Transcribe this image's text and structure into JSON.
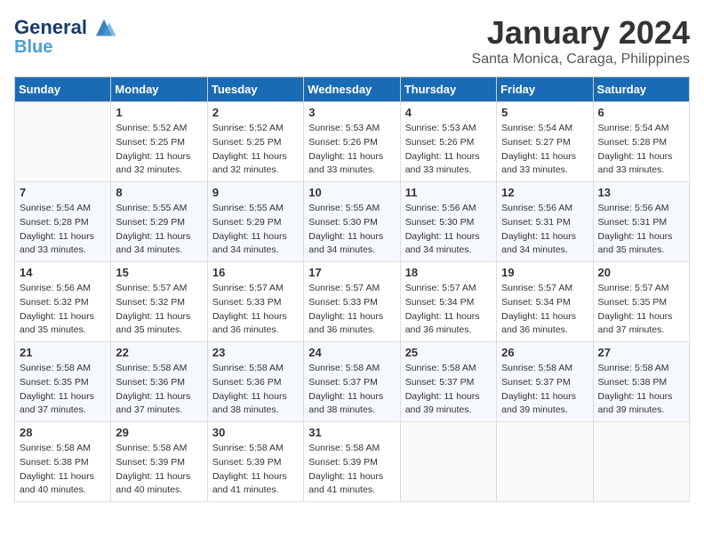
{
  "header": {
    "logo_line1": "General",
    "logo_line2": "Blue",
    "month_title": "January 2024",
    "location": "Santa Monica, Caraga, Philippines"
  },
  "days_header": [
    "Sunday",
    "Monday",
    "Tuesday",
    "Wednesday",
    "Thursday",
    "Friday",
    "Saturday"
  ],
  "weeks": [
    [
      {
        "num": "",
        "info": ""
      },
      {
        "num": "1",
        "info": "Sunrise: 5:52 AM\nSunset: 5:25 PM\nDaylight: 11 hours\nand 32 minutes."
      },
      {
        "num": "2",
        "info": "Sunrise: 5:52 AM\nSunset: 5:25 PM\nDaylight: 11 hours\nand 32 minutes."
      },
      {
        "num": "3",
        "info": "Sunrise: 5:53 AM\nSunset: 5:26 PM\nDaylight: 11 hours\nand 33 minutes."
      },
      {
        "num": "4",
        "info": "Sunrise: 5:53 AM\nSunset: 5:26 PM\nDaylight: 11 hours\nand 33 minutes."
      },
      {
        "num": "5",
        "info": "Sunrise: 5:54 AM\nSunset: 5:27 PM\nDaylight: 11 hours\nand 33 minutes."
      },
      {
        "num": "6",
        "info": "Sunrise: 5:54 AM\nSunset: 5:28 PM\nDaylight: 11 hours\nand 33 minutes."
      }
    ],
    [
      {
        "num": "7",
        "info": "Sunrise: 5:54 AM\nSunset: 5:28 PM\nDaylight: 11 hours\nand 33 minutes."
      },
      {
        "num": "8",
        "info": "Sunrise: 5:55 AM\nSunset: 5:29 PM\nDaylight: 11 hours\nand 34 minutes."
      },
      {
        "num": "9",
        "info": "Sunrise: 5:55 AM\nSunset: 5:29 PM\nDaylight: 11 hours\nand 34 minutes."
      },
      {
        "num": "10",
        "info": "Sunrise: 5:55 AM\nSunset: 5:30 PM\nDaylight: 11 hours\nand 34 minutes."
      },
      {
        "num": "11",
        "info": "Sunrise: 5:56 AM\nSunset: 5:30 PM\nDaylight: 11 hours\nand 34 minutes."
      },
      {
        "num": "12",
        "info": "Sunrise: 5:56 AM\nSunset: 5:31 PM\nDaylight: 11 hours\nand 34 minutes."
      },
      {
        "num": "13",
        "info": "Sunrise: 5:56 AM\nSunset: 5:31 PM\nDaylight: 11 hours\nand 35 minutes."
      }
    ],
    [
      {
        "num": "14",
        "info": "Sunrise: 5:56 AM\nSunset: 5:32 PM\nDaylight: 11 hours\nand 35 minutes."
      },
      {
        "num": "15",
        "info": "Sunrise: 5:57 AM\nSunset: 5:32 PM\nDaylight: 11 hours\nand 35 minutes."
      },
      {
        "num": "16",
        "info": "Sunrise: 5:57 AM\nSunset: 5:33 PM\nDaylight: 11 hours\nand 36 minutes."
      },
      {
        "num": "17",
        "info": "Sunrise: 5:57 AM\nSunset: 5:33 PM\nDaylight: 11 hours\nand 36 minutes."
      },
      {
        "num": "18",
        "info": "Sunrise: 5:57 AM\nSunset: 5:34 PM\nDaylight: 11 hours\nand 36 minutes."
      },
      {
        "num": "19",
        "info": "Sunrise: 5:57 AM\nSunset: 5:34 PM\nDaylight: 11 hours\nand 36 minutes."
      },
      {
        "num": "20",
        "info": "Sunrise: 5:57 AM\nSunset: 5:35 PM\nDaylight: 11 hours\nand 37 minutes."
      }
    ],
    [
      {
        "num": "21",
        "info": "Sunrise: 5:58 AM\nSunset: 5:35 PM\nDaylight: 11 hours\nand 37 minutes."
      },
      {
        "num": "22",
        "info": "Sunrise: 5:58 AM\nSunset: 5:36 PM\nDaylight: 11 hours\nand 37 minutes."
      },
      {
        "num": "23",
        "info": "Sunrise: 5:58 AM\nSunset: 5:36 PM\nDaylight: 11 hours\nand 38 minutes."
      },
      {
        "num": "24",
        "info": "Sunrise: 5:58 AM\nSunset: 5:37 PM\nDaylight: 11 hours\nand 38 minutes."
      },
      {
        "num": "25",
        "info": "Sunrise: 5:58 AM\nSunset: 5:37 PM\nDaylight: 11 hours\nand 39 minutes."
      },
      {
        "num": "26",
        "info": "Sunrise: 5:58 AM\nSunset: 5:37 PM\nDaylight: 11 hours\nand 39 minutes."
      },
      {
        "num": "27",
        "info": "Sunrise: 5:58 AM\nSunset: 5:38 PM\nDaylight: 11 hours\nand 39 minutes."
      }
    ],
    [
      {
        "num": "28",
        "info": "Sunrise: 5:58 AM\nSunset: 5:38 PM\nDaylight: 11 hours\nand 40 minutes."
      },
      {
        "num": "29",
        "info": "Sunrise: 5:58 AM\nSunset: 5:39 PM\nDaylight: 11 hours\nand 40 minutes."
      },
      {
        "num": "30",
        "info": "Sunrise: 5:58 AM\nSunset: 5:39 PM\nDaylight: 11 hours\nand 41 minutes."
      },
      {
        "num": "31",
        "info": "Sunrise: 5:58 AM\nSunset: 5:39 PM\nDaylight: 11 hours\nand 41 minutes."
      },
      {
        "num": "",
        "info": ""
      },
      {
        "num": "",
        "info": ""
      },
      {
        "num": "",
        "info": ""
      }
    ]
  ]
}
